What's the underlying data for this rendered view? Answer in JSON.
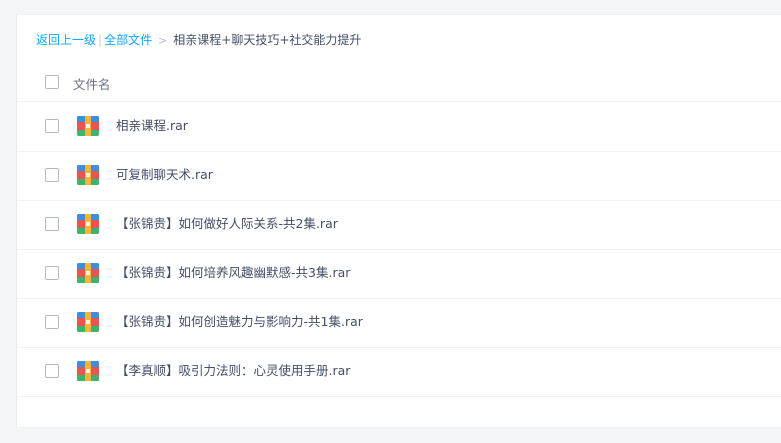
{
  "breadcrumb": {
    "back_label": "返回上一级",
    "separator": "|",
    "all_files_label": "全部文件",
    "chevron": ">",
    "current_folder": "相亲课程+聊天技巧+社交能力提升"
  },
  "list": {
    "header_label": "文件名",
    "files": [
      {
        "name": "相亲课程.rar",
        "icon": "rar-archive-icon"
      },
      {
        "name": "可复制聊天术.rar",
        "icon": "rar-archive-icon"
      },
      {
        "name": "【张锦贵】如何做好人际关系-共2集.rar",
        "icon": "rar-archive-icon"
      },
      {
        "name": "【张锦贵】如何培养风趣幽默感-共3集.rar",
        "icon": "rar-archive-icon"
      },
      {
        "name": "【张锦贵】如何创造魅力与影响力-共1集.rar",
        "icon": "rar-archive-icon"
      },
      {
        "name": "【李真顺】吸引力法则：心灵使用手册.rar",
        "icon": "rar-archive-icon"
      }
    ]
  },
  "colors": {
    "link": "#09aaff",
    "text": "#424e67",
    "icon_red": "#e8554e",
    "icon_blue": "#3f8ede",
    "icon_green": "#3fb36b",
    "icon_yellow": "#f3b53a"
  }
}
